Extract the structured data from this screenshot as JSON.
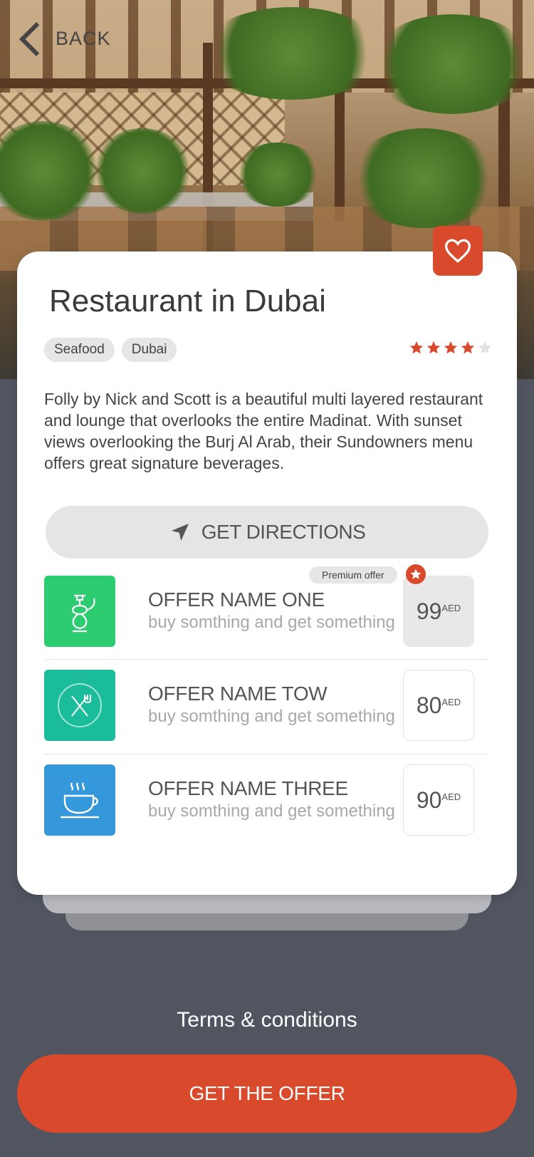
{
  "nav": {
    "back_label": "BACK"
  },
  "restaurant": {
    "title": "Restaurant in Dubai",
    "tags": [
      "Seafood",
      "Dubai"
    ],
    "rating": 4,
    "rating_max": 5,
    "description": "Folly by Nick and Scott is a beautiful multi layered restaurant and lounge that overlooks the entire Madinat. With sunset views overlooking the Burj Al Arab, their Sundowners menu offers great signature beverages."
  },
  "directions_label": "GET DIRECTIONS",
  "premium_label": "Premium offer",
  "offers": [
    {
      "name": "OFFER NAME ONE",
      "subtitle": "buy somthing and get something",
      "price": "99",
      "currency": "AED",
      "icon": "hookah-icon",
      "color": "#2ecc71"
    },
    {
      "name": "OFFER NAME TOW",
      "subtitle": "buy somthing and get something",
      "price": "80",
      "currency": "AED",
      "icon": "fork-knife-icon",
      "color": "#1abc9c"
    },
    {
      "name": "OFFER NAME THREE",
      "subtitle": "buy somthing and get something",
      "price": "90",
      "currency": "AED",
      "icon": "coffee-cup-icon",
      "color": "#3498db"
    }
  ],
  "terms_label": "Terms & conditions",
  "cta_label": "GET THE OFFER",
  "colors": {
    "accent": "#d9492b",
    "background": "#505560",
    "star": "#d9492b",
    "star_empty": "#e0e0e0"
  }
}
